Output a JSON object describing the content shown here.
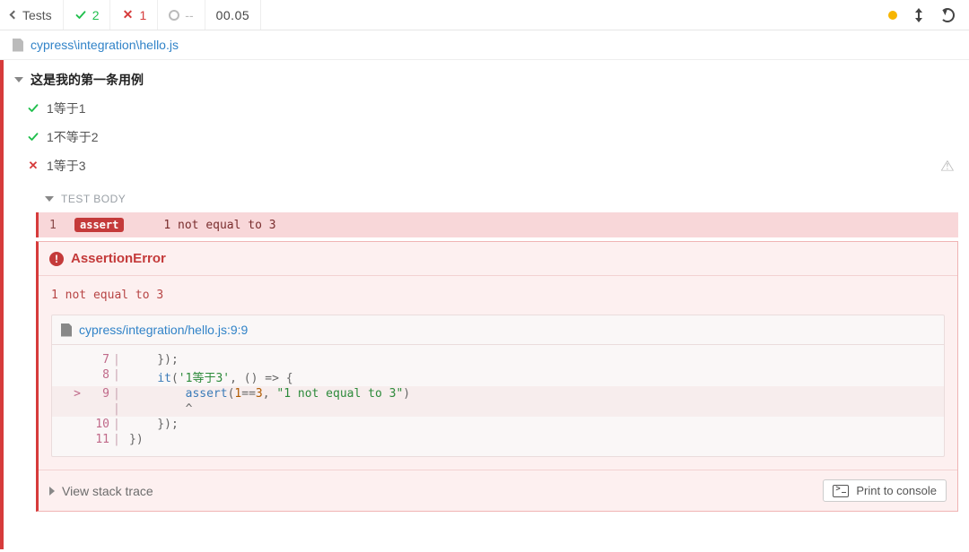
{
  "toolbar": {
    "tests_label": "Tests",
    "pass_count": "2",
    "fail_count": "1",
    "pending_count": "--",
    "time": "00.05"
  },
  "file_path": "cypress\\integration\\hello.js",
  "suite_title": "这是我的第一条用例",
  "tests": [
    {
      "status": "pass",
      "label": "1等于1"
    },
    {
      "status": "pass",
      "label": "1不等于2"
    },
    {
      "status": "fail",
      "label": "1等于3"
    }
  ],
  "test_body_label": "TEST BODY",
  "command": {
    "num": "1",
    "badge": "assert",
    "message": "1 not equal to 3"
  },
  "error": {
    "title": "AssertionError",
    "message": "1 not equal to 3",
    "frame_path": "cypress/integration/hello.js:9:9",
    "stack_label": "View stack trace",
    "print_label": "Print to console",
    "code": [
      {
        "mark": "",
        "num": "7",
        "text_plain": "    });"
      },
      {
        "mark": "",
        "num": "8",
        "text_segs": [
          {
            "t": "    ",
            "c": "punc"
          },
          {
            "t": "it",
            "c": "fn"
          },
          {
            "t": "(",
            "c": "punc"
          },
          {
            "t": "'1等于3'",
            "c": "str"
          },
          {
            "t": ", () ",
            "c": "punc"
          },
          {
            "t": "=>",
            "c": "op"
          },
          {
            "t": " {",
            "c": "punc"
          }
        ]
      },
      {
        "mark": ">",
        "num": "9",
        "hl": true,
        "text_segs": [
          {
            "t": "        ",
            "c": "punc"
          },
          {
            "t": "assert",
            "c": "fn"
          },
          {
            "t": "(",
            "c": "punc"
          },
          {
            "t": "1",
            "c": "num"
          },
          {
            "t": "==",
            "c": "op"
          },
          {
            "t": "3",
            "c": "num"
          },
          {
            "t": ", ",
            "c": "punc"
          },
          {
            "t": "\"1 not equal to 3\"",
            "c": "str"
          },
          {
            "t": ")",
            "c": "punc"
          }
        ]
      },
      {
        "mark": "",
        "num": "",
        "hl": true,
        "text_plain": "        ^"
      },
      {
        "mark": "",
        "num": "10",
        "text_plain": "    });"
      },
      {
        "mark": "",
        "num": "11",
        "text_segs": [
          {
            "t": "})",
            "c": "punc"
          }
        ]
      }
    ]
  }
}
